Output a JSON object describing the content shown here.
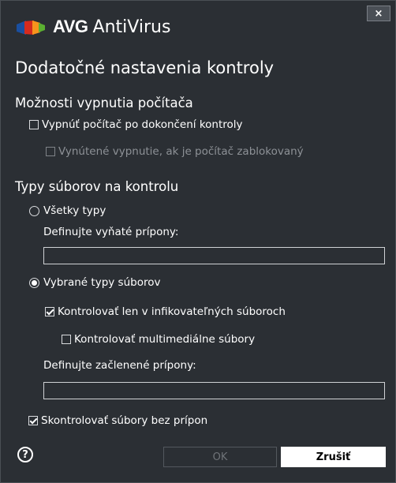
{
  "app": {
    "brand": "AVG",
    "product": "AntiVirus",
    "close_label": "×"
  },
  "page": {
    "title": "Dodatočné nastavenia kontroly"
  },
  "shutdown": {
    "title": "Možnosti vypnutia počítača",
    "shutdown_after_scan": {
      "label": "Vypnúť počítač po dokončení kontroly",
      "checked": false
    },
    "force_shutdown": {
      "label": "Vynútené vypnutie, ak je počítač zablokovaný",
      "checked": false,
      "disabled": true
    }
  },
  "file_types": {
    "title": "Typy súborov na kontrolu",
    "all_types": {
      "label": "Všetky typy",
      "selected": false
    },
    "excluded_label": "Definujte vyňaté prípony:",
    "excluded_value": "",
    "selected_types": {
      "label": "Vybrané typy súborov",
      "selected": true
    },
    "infectable_only": {
      "label": "Kontrolovať len v infikovateľných súboroch",
      "checked": true
    },
    "multimedia": {
      "label": "Kontrolovať multimediálne súbory",
      "checked": false
    },
    "included_label": "Definujte začlenené prípony:",
    "included_value": "",
    "no_extension": {
      "label": "Skontrolovať súbory bez prípon",
      "checked": true
    }
  },
  "footer": {
    "help_icon": "?",
    "ok_label": "OK",
    "cancel_label": "Zrušiť"
  },
  "colors": {
    "background": "#2b2f34",
    "text": "#ffffff",
    "disabled_text": "#8d9196",
    "logo_blue": "#1a4fa0",
    "logo_red": "#d52b1e",
    "logo_orange": "#f7941d",
    "logo_green": "#5bb031"
  }
}
